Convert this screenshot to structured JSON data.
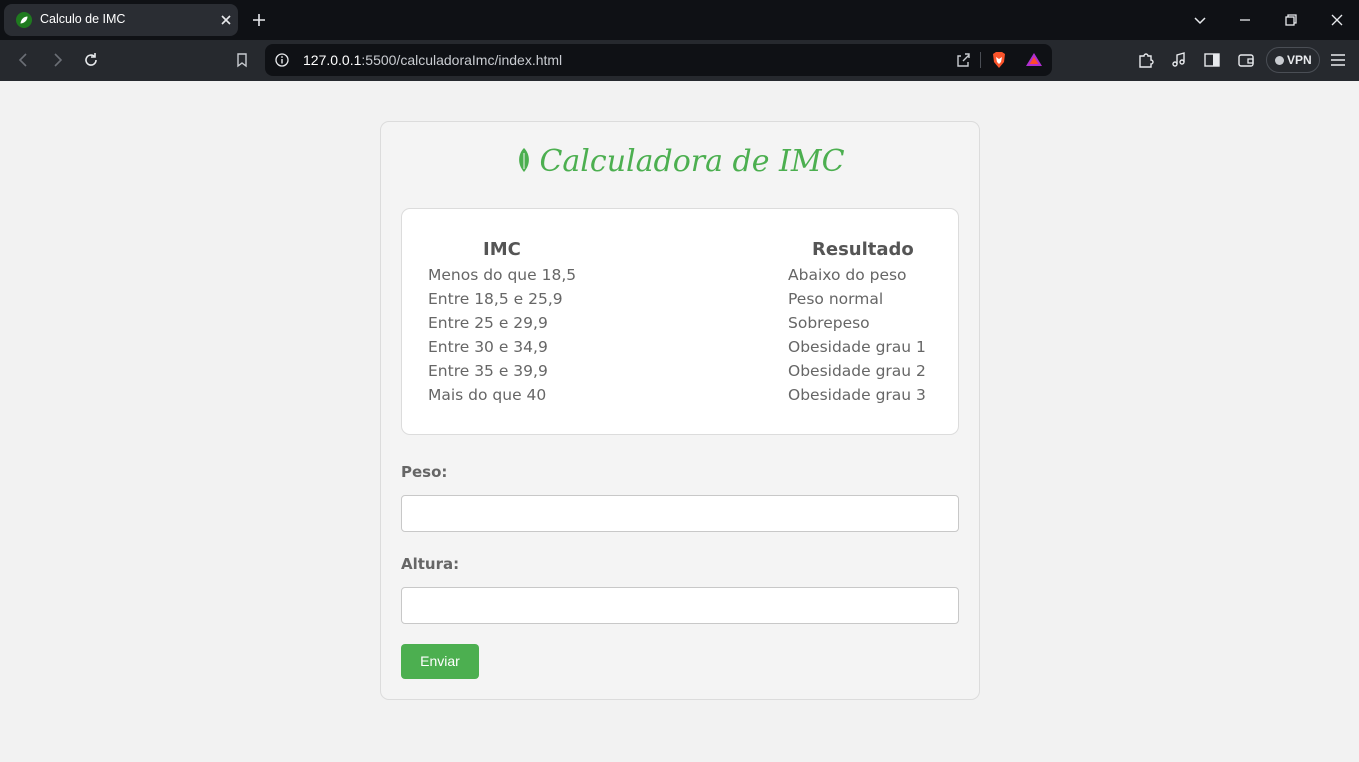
{
  "browser": {
    "tab_title": "Calculo de IMC",
    "url_host": "127.0.0.1",
    "url_rest": ":5500/calculadoraImc/index.html",
    "vpn_label": "VPN"
  },
  "page": {
    "heading": "Calculadora de IMC",
    "accent_color": "#4caf50",
    "table": {
      "headers": [
        "IMC",
        "Resultado"
      ],
      "rows": [
        [
          "Menos do que 18,5",
          "Abaixo do peso"
        ],
        [
          "Entre 18,5 e 25,9",
          "Peso normal"
        ],
        [
          "Entre 25 e 29,9",
          "Sobrepeso"
        ],
        [
          "Entre 30 e 34,9",
          "Obesidade grau 1"
        ],
        [
          "Entre 35 e 39,9",
          "Obesidade grau 2"
        ],
        [
          "Mais do que 40",
          "Obesidade grau 3"
        ]
      ]
    },
    "form": {
      "peso_label": "Peso:",
      "peso_value": "",
      "altura_label": "Altura:",
      "altura_value": "",
      "submit_label": "Enviar"
    }
  }
}
